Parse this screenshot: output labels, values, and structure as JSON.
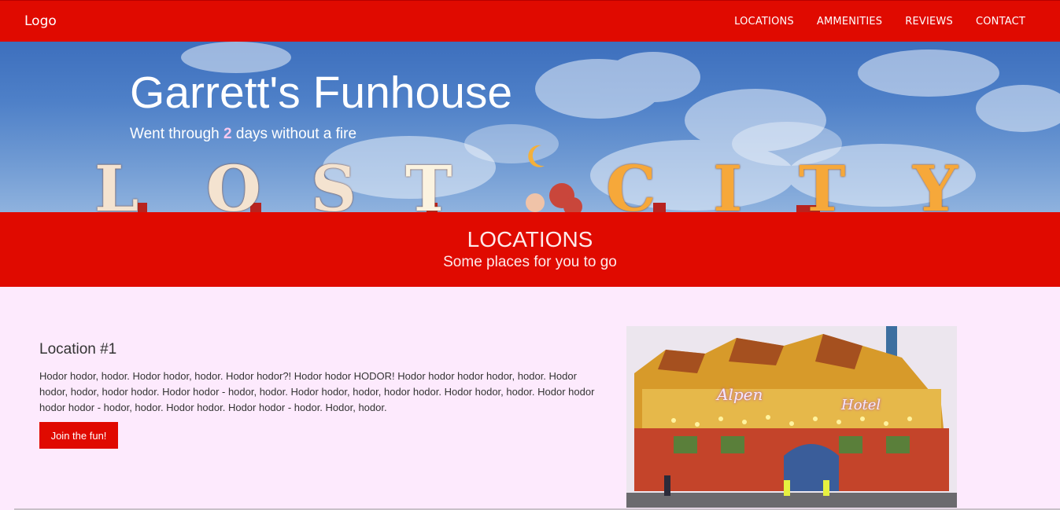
{
  "navbar": {
    "logo": "Logo",
    "links": [
      "LOCATIONS",
      "AMMENITIES",
      "REVIEWS",
      "CONTACT"
    ]
  },
  "hero": {
    "title": "Garrett's Funhouse",
    "subtitle_before": "Went through ",
    "subtitle_count": "2",
    "subtitle_after": " days without a fire",
    "sign_letters": [
      "L",
      "O",
      "S",
      "T",
      "C",
      "I",
      "T",
      "Y"
    ]
  },
  "locations_section": {
    "title": "LOCATIONS",
    "subtitle": "Some places for you to go"
  },
  "location1": {
    "heading": "Location #1",
    "body": "Hodor hodor, hodor. Hodor hodor, hodor. Hodor hodor?! Hodor hodor HODOR! Hodor hodor hodor hodor, hodor. Hodor hodor, hodor, hodor hodor. Hodor hodor - hodor, hodor. Hodor hodor, hodor, hodor hodor. Hodor hodor, hodor. Hodor hodor hodor hodor - hodor, hodor. Hodor hodor. Hodor hodor - hodor. Hodor, hodor.",
    "button_label": "Join the fun!",
    "photo_sign_left": "Alpen",
    "photo_sign_right": "Hotel"
  },
  "colors": {
    "brand_red": "#e00a00",
    "page_background": "#fdeafd",
    "sky_blue": "#4e80c8"
  }
}
